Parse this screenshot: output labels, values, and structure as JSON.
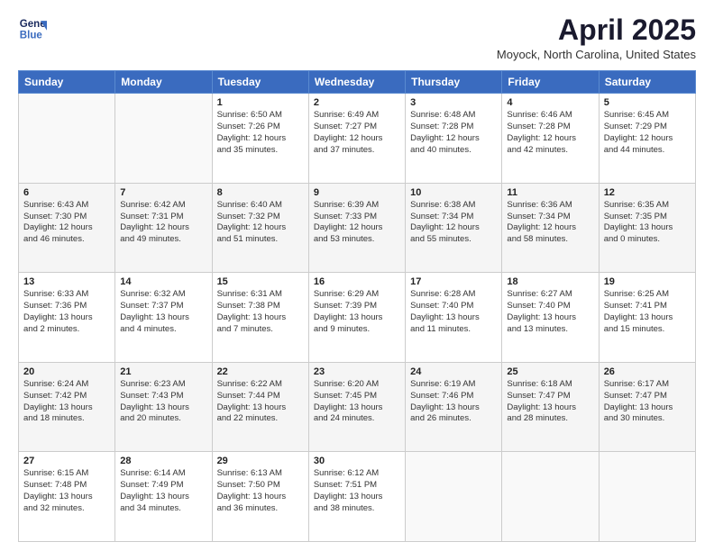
{
  "header": {
    "logo_line1": "General",
    "logo_line2": "Blue",
    "month_title": "April 2025",
    "location": "Moyock, North Carolina, United States"
  },
  "days_of_week": [
    "Sunday",
    "Monday",
    "Tuesday",
    "Wednesday",
    "Thursday",
    "Friday",
    "Saturday"
  ],
  "weeks": [
    [
      {
        "day": "",
        "info": ""
      },
      {
        "day": "",
        "info": ""
      },
      {
        "day": "1",
        "info": "Sunrise: 6:50 AM\nSunset: 7:26 PM\nDaylight: 12 hours\nand 35 minutes."
      },
      {
        "day": "2",
        "info": "Sunrise: 6:49 AM\nSunset: 7:27 PM\nDaylight: 12 hours\nand 37 minutes."
      },
      {
        "day": "3",
        "info": "Sunrise: 6:48 AM\nSunset: 7:28 PM\nDaylight: 12 hours\nand 40 minutes."
      },
      {
        "day": "4",
        "info": "Sunrise: 6:46 AM\nSunset: 7:28 PM\nDaylight: 12 hours\nand 42 minutes."
      },
      {
        "day": "5",
        "info": "Sunrise: 6:45 AM\nSunset: 7:29 PM\nDaylight: 12 hours\nand 44 minutes."
      }
    ],
    [
      {
        "day": "6",
        "info": "Sunrise: 6:43 AM\nSunset: 7:30 PM\nDaylight: 12 hours\nand 46 minutes."
      },
      {
        "day": "7",
        "info": "Sunrise: 6:42 AM\nSunset: 7:31 PM\nDaylight: 12 hours\nand 49 minutes."
      },
      {
        "day": "8",
        "info": "Sunrise: 6:40 AM\nSunset: 7:32 PM\nDaylight: 12 hours\nand 51 minutes."
      },
      {
        "day": "9",
        "info": "Sunrise: 6:39 AM\nSunset: 7:33 PM\nDaylight: 12 hours\nand 53 minutes."
      },
      {
        "day": "10",
        "info": "Sunrise: 6:38 AM\nSunset: 7:34 PM\nDaylight: 12 hours\nand 55 minutes."
      },
      {
        "day": "11",
        "info": "Sunrise: 6:36 AM\nSunset: 7:34 PM\nDaylight: 12 hours\nand 58 minutes."
      },
      {
        "day": "12",
        "info": "Sunrise: 6:35 AM\nSunset: 7:35 PM\nDaylight: 13 hours\nand 0 minutes."
      }
    ],
    [
      {
        "day": "13",
        "info": "Sunrise: 6:33 AM\nSunset: 7:36 PM\nDaylight: 13 hours\nand 2 minutes."
      },
      {
        "day": "14",
        "info": "Sunrise: 6:32 AM\nSunset: 7:37 PM\nDaylight: 13 hours\nand 4 minutes."
      },
      {
        "day": "15",
        "info": "Sunrise: 6:31 AM\nSunset: 7:38 PM\nDaylight: 13 hours\nand 7 minutes."
      },
      {
        "day": "16",
        "info": "Sunrise: 6:29 AM\nSunset: 7:39 PM\nDaylight: 13 hours\nand 9 minutes."
      },
      {
        "day": "17",
        "info": "Sunrise: 6:28 AM\nSunset: 7:40 PM\nDaylight: 13 hours\nand 11 minutes."
      },
      {
        "day": "18",
        "info": "Sunrise: 6:27 AM\nSunset: 7:40 PM\nDaylight: 13 hours\nand 13 minutes."
      },
      {
        "day": "19",
        "info": "Sunrise: 6:25 AM\nSunset: 7:41 PM\nDaylight: 13 hours\nand 15 minutes."
      }
    ],
    [
      {
        "day": "20",
        "info": "Sunrise: 6:24 AM\nSunset: 7:42 PM\nDaylight: 13 hours\nand 18 minutes."
      },
      {
        "day": "21",
        "info": "Sunrise: 6:23 AM\nSunset: 7:43 PM\nDaylight: 13 hours\nand 20 minutes."
      },
      {
        "day": "22",
        "info": "Sunrise: 6:22 AM\nSunset: 7:44 PM\nDaylight: 13 hours\nand 22 minutes."
      },
      {
        "day": "23",
        "info": "Sunrise: 6:20 AM\nSunset: 7:45 PM\nDaylight: 13 hours\nand 24 minutes."
      },
      {
        "day": "24",
        "info": "Sunrise: 6:19 AM\nSunset: 7:46 PM\nDaylight: 13 hours\nand 26 minutes."
      },
      {
        "day": "25",
        "info": "Sunrise: 6:18 AM\nSunset: 7:47 PM\nDaylight: 13 hours\nand 28 minutes."
      },
      {
        "day": "26",
        "info": "Sunrise: 6:17 AM\nSunset: 7:47 PM\nDaylight: 13 hours\nand 30 minutes."
      }
    ],
    [
      {
        "day": "27",
        "info": "Sunrise: 6:15 AM\nSunset: 7:48 PM\nDaylight: 13 hours\nand 32 minutes."
      },
      {
        "day": "28",
        "info": "Sunrise: 6:14 AM\nSunset: 7:49 PM\nDaylight: 13 hours\nand 34 minutes."
      },
      {
        "day": "29",
        "info": "Sunrise: 6:13 AM\nSunset: 7:50 PM\nDaylight: 13 hours\nand 36 minutes."
      },
      {
        "day": "30",
        "info": "Sunrise: 6:12 AM\nSunset: 7:51 PM\nDaylight: 13 hours\nand 38 minutes."
      },
      {
        "day": "",
        "info": ""
      },
      {
        "day": "",
        "info": ""
      },
      {
        "day": "",
        "info": ""
      }
    ]
  ]
}
